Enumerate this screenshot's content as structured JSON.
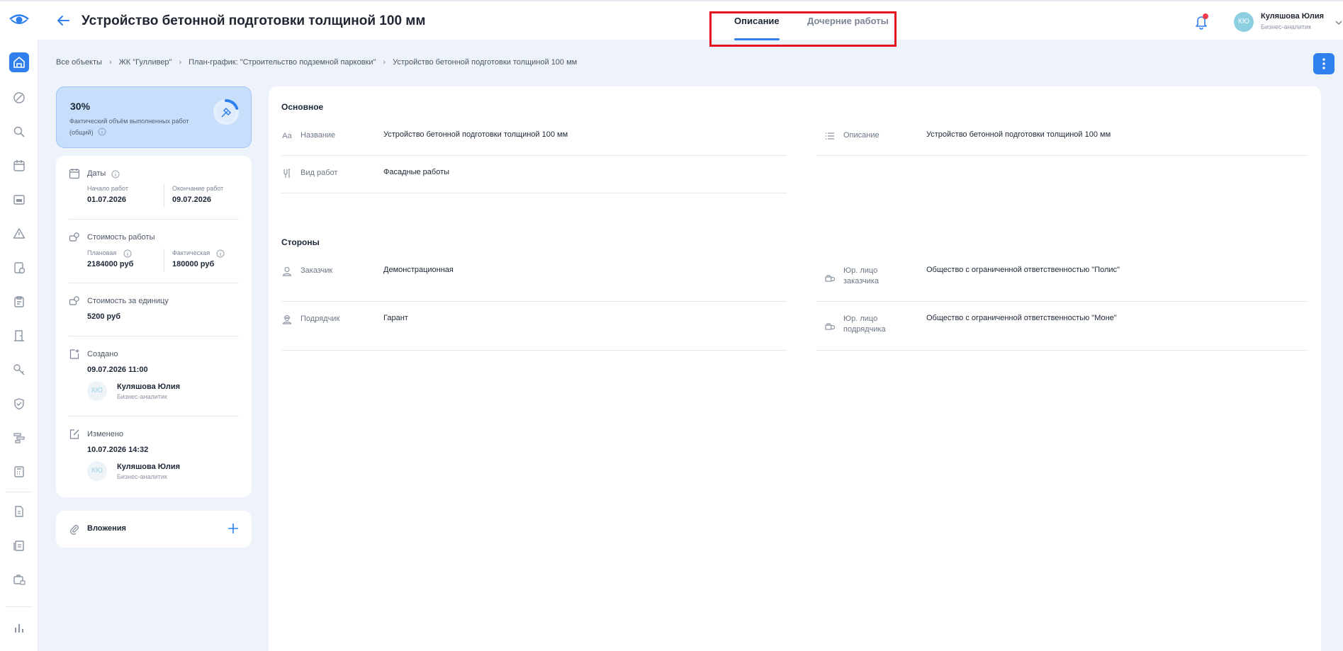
{
  "header": {
    "title": "Устройство бетонной подготовки толщиной 100 мм",
    "tabs": [
      {
        "label": "Описание",
        "active": true
      },
      {
        "label": "Дочерние работы",
        "active": false
      }
    ],
    "user": {
      "initials": "КЮ",
      "name": "Куляшова Юлия",
      "role": "Бизнес-аналитик"
    }
  },
  "breadcrumb": [
    "Все объекты",
    "ЖК \"Гулливер\"",
    "План-график: \"Строительство подземной парковки\"",
    "Устройство бетонной подготовки толщиной 100 мм"
  ],
  "progress": {
    "value": "30%",
    "label": "Фактический объём выполненных работ (общий)"
  },
  "details": {
    "dates": {
      "title": "Даты",
      "start_label": "Начало работ",
      "start_value": "01.07.2026",
      "end_label": "Окончание работ",
      "end_value": "09.07.2026"
    },
    "cost": {
      "title": "Стоимость работы",
      "planned_label": "Плановая",
      "planned_value": "2184000 руб",
      "actual_label": "Фактическая",
      "actual_value": "180000 руб"
    },
    "unit_cost": {
      "title": "Стоимость за единицу",
      "value": "5200 руб"
    },
    "created": {
      "title": "Создано",
      "datetime": "09.07.2026 11:00",
      "initials": "КЮ",
      "name": "Куляшова Юлия",
      "role": "Бизнес-аналитик"
    },
    "modified": {
      "title": "Изменено",
      "datetime": "10.07.2026 14:32",
      "initials": "КЮ",
      "name": "Куляшова Юлия",
      "role": "Бизнес-аналитик"
    }
  },
  "attachments": {
    "title": "Вложения"
  },
  "main": {
    "basic": {
      "title": "Основное",
      "name_icon": "Aa",
      "name_label": "Название",
      "name_value": "Устройство бетонной подготовки толщиной 100 мм",
      "desc_label": "Описание",
      "desc_value": "Устройство бетонной подготовки толщиной 100 мм",
      "work_type_label": "Вид работ",
      "work_type_value": "Фасадные работы"
    },
    "parties": {
      "title": "Стороны",
      "customer_label": "Заказчик",
      "customer_value": "Демонстрационная",
      "customer_entity_label": "Юр. лицо заказчика",
      "customer_entity_value": "Общество с ограниченной ответственностью \"Полис\"",
      "contractor_label": "Подрядчик",
      "contractor_value": "Гарант",
      "contractor_entity_label": "Юр. лицо подрядчика",
      "contractor_entity_value": "Общество с ограниченной ответственностью \"Моне\""
    }
  },
  "colors": {
    "accent": "#2f80ed",
    "highlight": "#e4131d",
    "notification": "#f23b4b"
  }
}
